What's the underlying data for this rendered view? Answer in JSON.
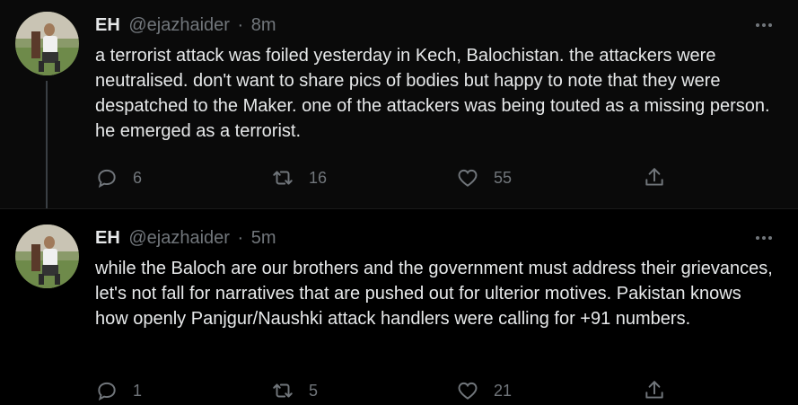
{
  "colors": {
    "background": "#000000",
    "text": "#e7e9ea",
    "secondary": "#71767b"
  },
  "tweets": [
    {
      "name": "EH",
      "handle": "@ejazhaider",
      "separator": "·",
      "time": "8m",
      "text": "a terrorist attack was foiled yesterday in Kech, Balochistan. the attackers were neutralised. don't want to share pics of bodies but happy to note that they were despatched to the Maker. one of the attackers was being touted as a missing person. he emerged as a terrorist.",
      "replies": "6",
      "retweets": "16",
      "likes": "55"
    },
    {
      "name": "EH",
      "handle": "@ejazhaider",
      "separator": "·",
      "time": "5m",
      "text": "while the Baloch are our brothers and the government must address their grievances, let's not fall for narratives that are pushed out for ulterior motives. Pakistan knows how openly Panjgur/Naushki attack handlers were calling for +91 numbers.",
      "replies": "1",
      "retweets": "5",
      "likes": "21"
    }
  ],
  "icons": {
    "reply": "reply-icon",
    "retweet": "retweet-icon",
    "like": "heart-icon",
    "share": "share-icon",
    "more": "more-icon"
  }
}
